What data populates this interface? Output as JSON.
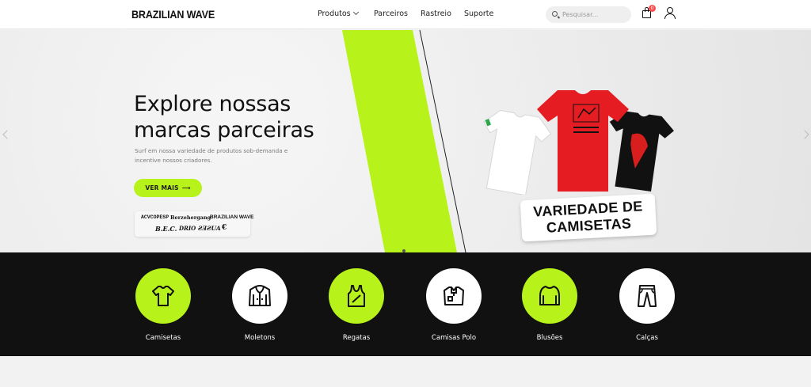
{
  "brand": {
    "logo": "BRAZILIAN WAVE"
  },
  "nav": {
    "items": [
      "Produtos",
      "Parceiros",
      "Rastreio",
      "Suporte"
    ]
  },
  "search": {
    "placeholder": "Pesquisar..."
  },
  "cart": {
    "count": "0"
  },
  "hero": {
    "title_line1": "Explore nossas",
    "title_line2": "marcas parceiras",
    "subtitle": "Surf em nossa variedade de produtos sob-demanda e incentive nossos criadores.",
    "cta": "VER MAIS",
    "cta_arrow": "⟶",
    "promo_line1": "VARIEDADE DE",
    "promo_line2": "CAMISETAS",
    "accent_color": "#b7f21a",
    "partner_brands": [
      "ACVCOPESP",
      "Berzehergang",
      "BRAZILIAN WAVE",
      "B.E.C.",
      "DRIO",
      "ƧƎƧUA",
      "€"
    ]
  },
  "categories": [
    {
      "label": "Camisetas",
      "icon": "tshirt-icon",
      "style": "green"
    },
    {
      "label": "Moletons",
      "icon": "hoodie-icon",
      "style": "white"
    },
    {
      "label": "Regatas",
      "icon": "tank-top-icon",
      "style": "green"
    },
    {
      "label": "Camisas Polo",
      "icon": "polo-shirt-icon",
      "style": "white"
    },
    {
      "label": "Blusões",
      "icon": "sweater-icon",
      "style": "green"
    },
    {
      "label": "Calças",
      "icon": "pants-icon",
      "style": "white"
    }
  ]
}
